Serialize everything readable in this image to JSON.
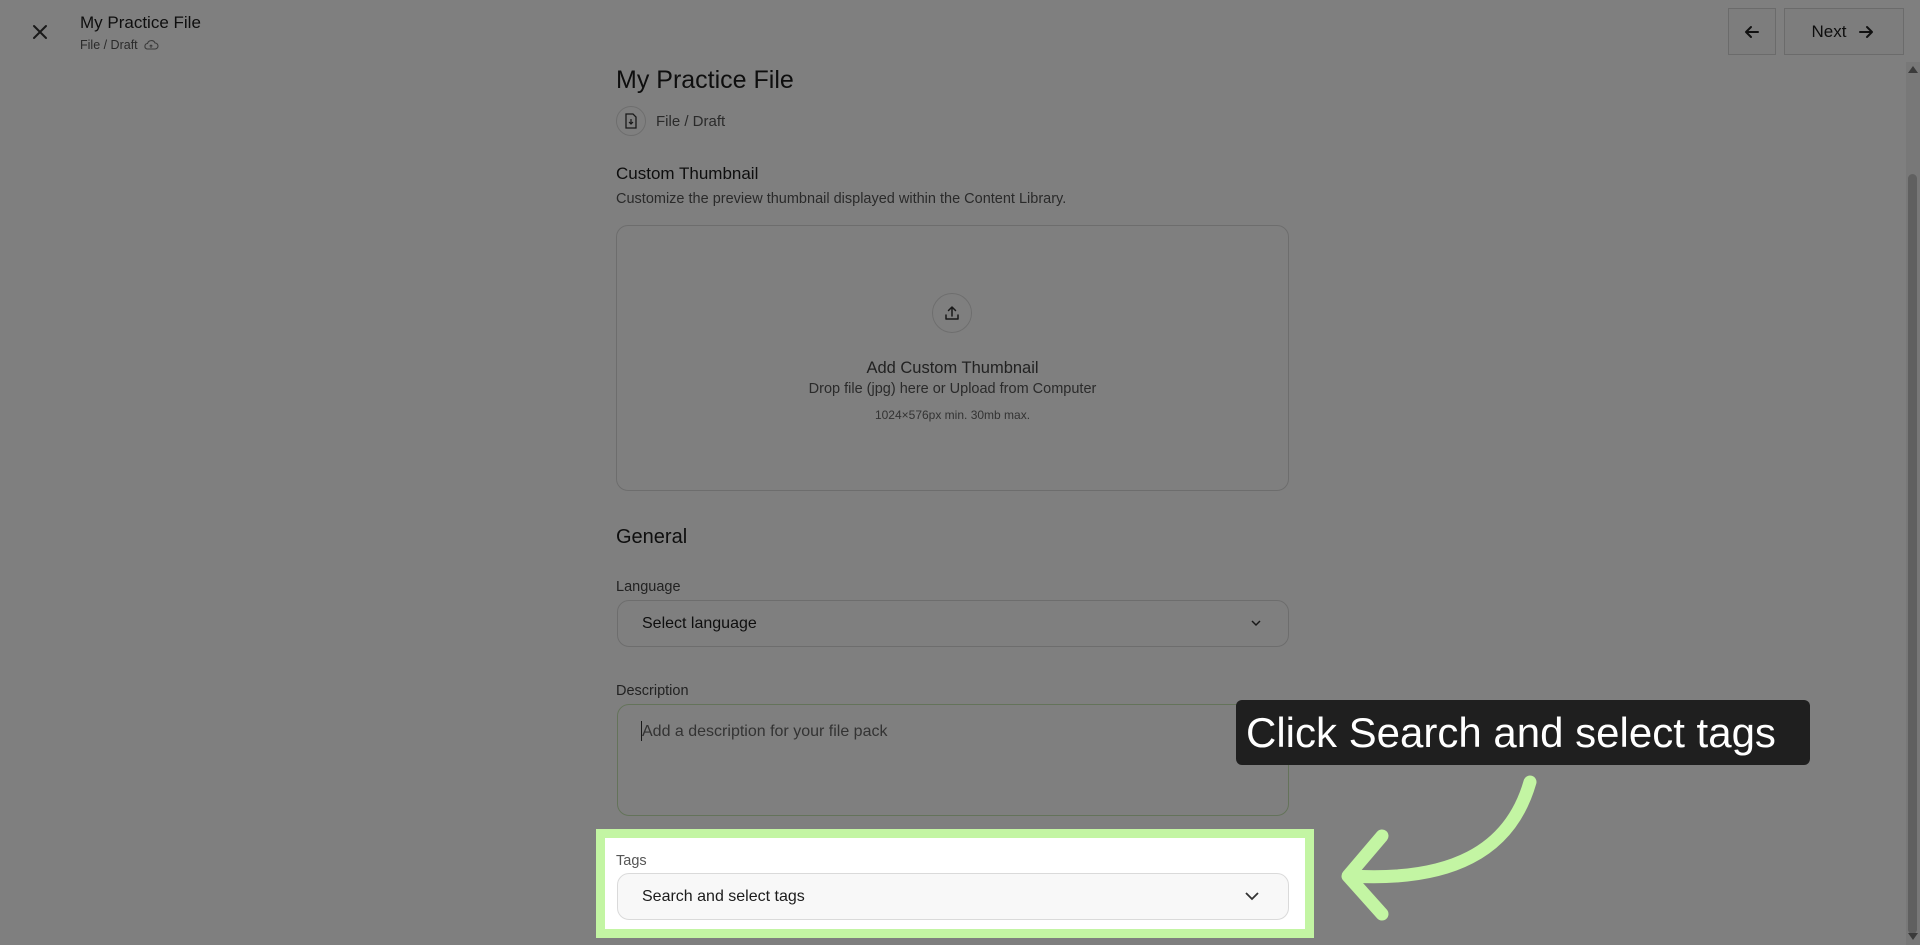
{
  "header": {
    "title": "My Practice File",
    "subtitle": "File / Draft",
    "next_label": "Next"
  },
  "main": {
    "title": "My Practice File",
    "file_crumb": "File / Draft",
    "thumbnail": {
      "label": "Custom Thumbnail",
      "description": "Customize the preview thumbnail displayed within the Content Library.",
      "dropzone_title": "Add Custom Thumbnail",
      "dropzone_sub": "Drop file (jpg) here or Upload from Computer",
      "dropzone_hint": "1024×576px min. 30mb max."
    },
    "general_heading": "General",
    "language": {
      "label": "Language",
      "value": "Select language"
    },
    "description": {
      "label": "Description",
      "placeholder": "Add a description for your file pack"
    },
    "tags": {
      "label": "Tags",
      "value": "Search and select tags"
    }
  },
  "callout": {
    "text": "Click Search and select tags"
  },
  "colors": {
    "highlight": "#c3f5a3",
    "callout_bg": "#1f1f1f",
    "overlay": "rgba(0,0,0,0.5)"
  }
}
